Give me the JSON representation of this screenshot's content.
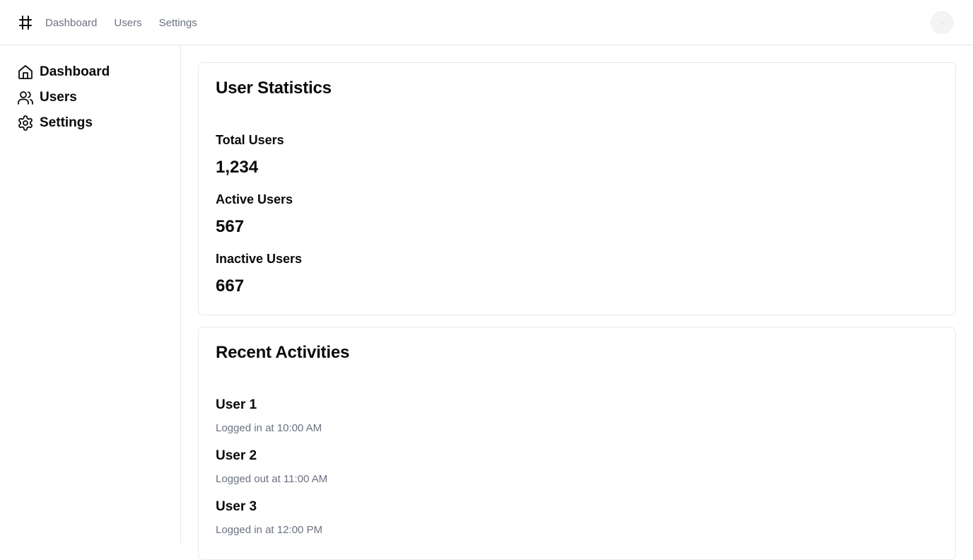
{
  "header": {
    "logo_icon": "hash-icon",
    "nav": [
      {
        "label": "Dashboard"
      },
      {
        "label": "Users"
      },
      {
        "label": "Settings"
      }
    ]
  },
  "sidebar": {
    "items": [
      {
        "label": "Dashboard",
        "icon": "home-icon"
      },
      {
        "label": "Users",
        "icon": "users-icon"
      },
      {
        "label": "Settings",
        "icon": "gear-icon"
      }
    ]
  },
  "stats": {
    "title": "User Statistics",
    "items": [
      {
        "label": "Total Users",
        "value": "1,234"
      },
      {
        "label": "Active Users",
        "value": "567"
      },
      {
        "label": "Inactive Users",
        "value": "667"
      }
    ]
  },
  "activities": {
    "title": "Recent Activities",
    "items": [
      {
        "user": "User 1",
        "description": "Logged in at 10:00 AM"
      },
      {
        "user": "User 2",
        "description": "Logged out at 11:00 AM"
      },
      {
        "user": "User 3",
        "description": "Logged in at 12:00 PM"
      }
    ]
  },
  "colors": {
    "text": "#0a0a0a",
    "muted": "#6b7280",
    "border": "#e5e7eb"
  }
}
